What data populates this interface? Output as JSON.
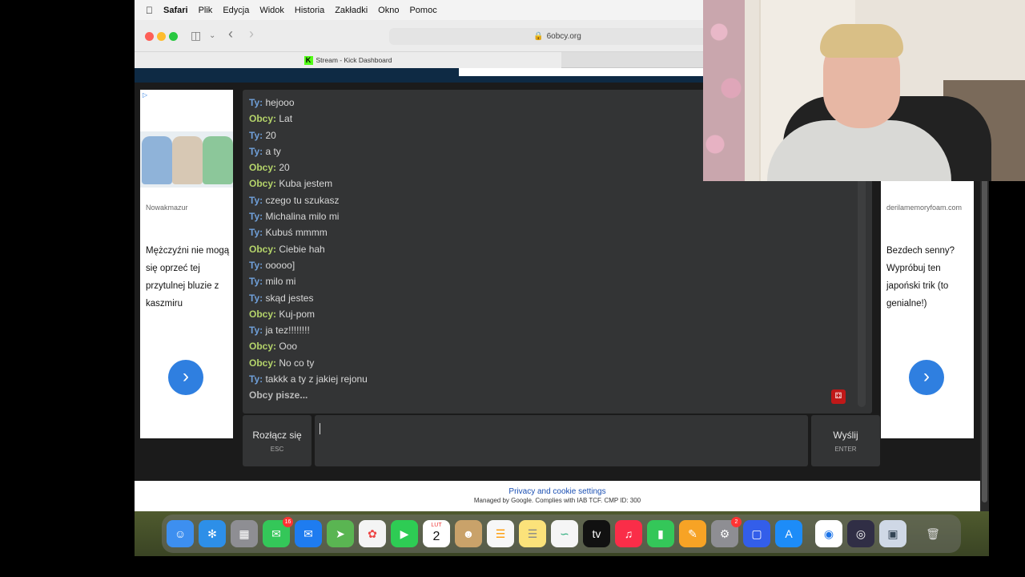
{
  "menubar": {
    "apple": "",
    "app": "Safari",
    "items": [
      "Plik",
      "Edycja",
      "Widok",
      "Historia",
      "Zakładki",
      "Okno",
      "Pomoc"
    ]
  },
  "browser": {
    "url": "6obcy.org",
    "tabs": [
      {
        "label": "Stream - Kick Dashboard"
      }
    ]
  },
  "ads": {
    "left": {
      "brand": "Nowakmazur",
      "text": "Mężczyźni nie mogą się oprzeć tej przytulnej bluzie z kaszmiru",
      "button": "›"
    },
    "right": {
      "brand": "derilamemoryfoam.com",
      "text": "Bezdech senny? Wypróbuj ten japoński trik (to genialne!)",
      "button": "›"
    }
  },
  "chat": {
    "messages": [
      {
        "who": "Ty:",
        "text": "hejooo"
      },
      {
        "who": "Obcy:",
        "text": "Lat"
      },
      {
        "who": "Ty:",
        "text": "20"
      },
      {
        "who": "Ty:",
        "text": "a ty"
      },
      {
        "who": "Obcy:",
        "text": "20"
      },
      {
        "who": "Obcy:",
        "text": "Kuba jestem"
      },
      {
        "who": "Ty:",
        "text": "czego tu szukasz"
      },
      {
        "who": "Ty:",
        "text": "Michalina milo mi"
      },
      {
        "who": "Ty:",
        "text": "Kubuś mmmm"
      },
      {
        "who": "Obcy:",
        "text": "Ciebie hah"
      },
      {
        "who": "Ty:",
        "text": "ooooo]"
      },
      {
        "who": "Ty:",
        "text": "milo mi"
      },
      {
        "who": "Ty:",
        "text": "skąd jestes"
      },
      {
        "who": "Obcy:",
        "text": "Kuj-pom"
      },
      {
        "who": "Ty:",
        "text": "ja tez!!!!!!!!"
      },
      {
        "who": "Obcy:",
        "text": "Ooo"
      },
      {
        "who": "Obcy:",
        "text": "No co ty"
      },
      {
        "who": "Ty:",
        "text": "takkk a ty z jakiej rejonu"
      }
    ],
    "typing": "Obcy pisze...",
    "disconnect": {
      "label": "Rozłącz się",
      "key": "ESC"
    },
    "send": {
      "label": "Wyślij",
      "key": "ENTER"
    },
    "input_value": ""
  },
  "footer": {
    "link": "Privacy and cookie settings",
    "note": "Managed by Google. Complies with IAB TCF. CMP ID: 300"
  },
  "dock": {
    "calendar_month": "LUT",
    "calendar_day": "2",
    "messages_badge": "16",
    "settings_badge": "2"
  }
}
